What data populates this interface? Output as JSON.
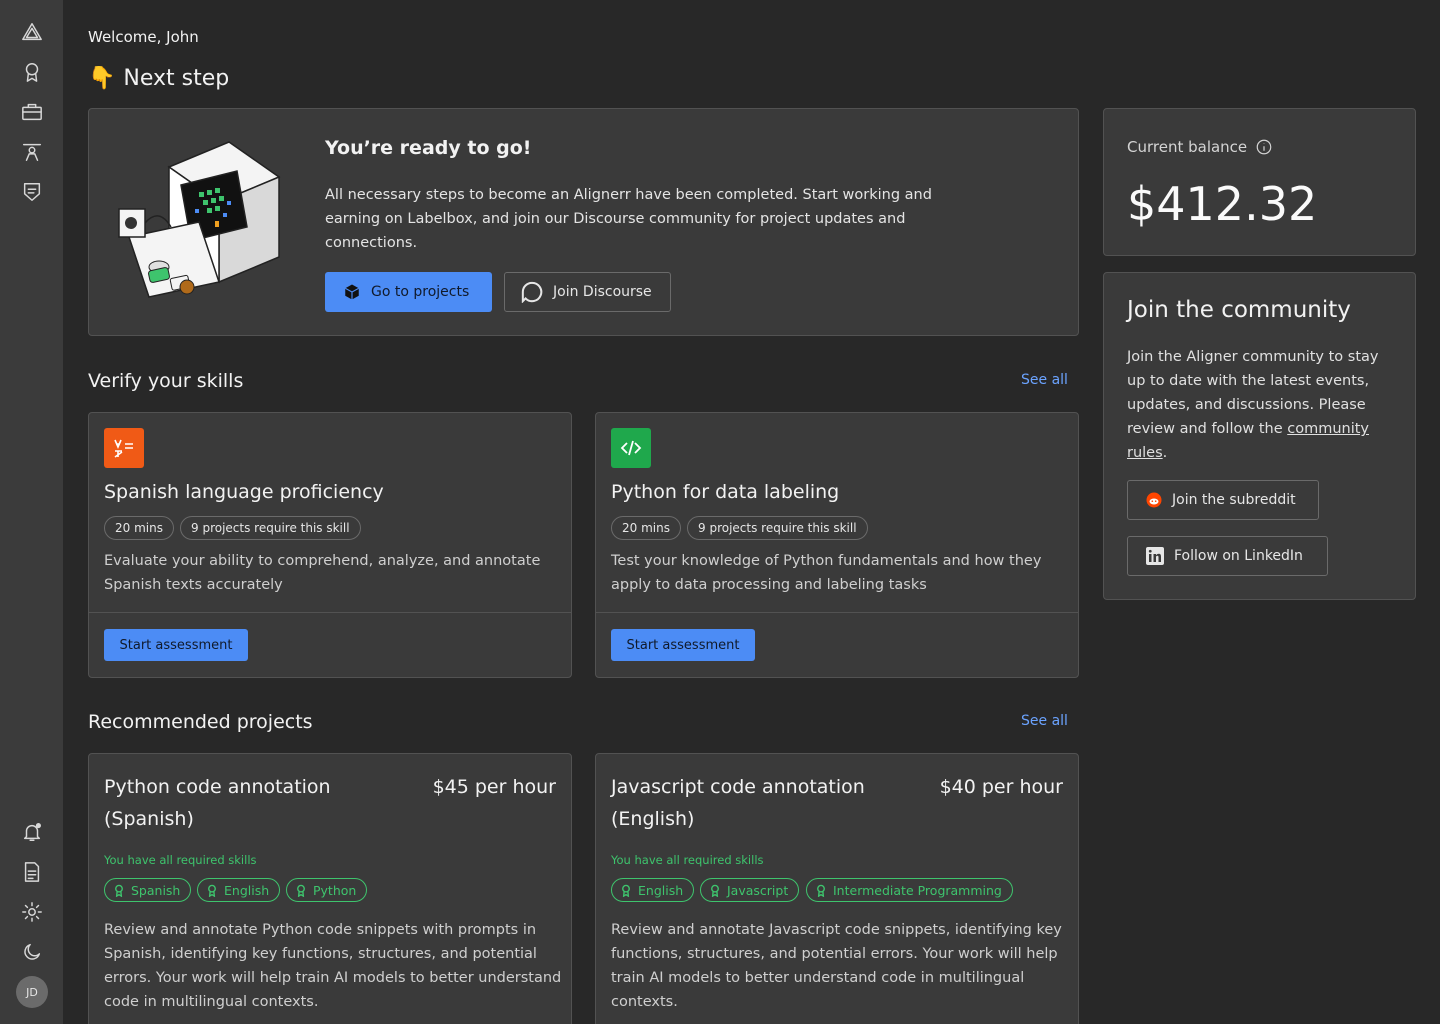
{
  "header": {
    "welcome": "Welcome, John",
    "next_step_emoji": "👇",
    "next_step": "Next step"
  },
  "sidebar": {
    "top_icons": [
      "logo-icon",
      "award-icon",
      "briefcase-icon",
      "teacher-icon",
      "shield-icon"
    ],
    "bottom_icons": [
      "bell-icon",
      "document-icon",
      "gear-icon",
      "moon-icon"
    ],
    "avatar_initials": "JD"
  },
  "hero": {
    "title": "You’re ready to go!",
    "description": "All necessary steps to become an Alignerr have been completed. Start working and earning on Labelbox, and join our Discourse community for project updates and connections.",
    "primary_button": "Go to projects",
    "secondary_button": "Join Discourse"
  },
  "skills": {
    "title": "Verify your skills",
    "see_all": "See all",
    "items": [
      {
        "name": "Spanish language proficiency",
        "duration": "20 mins",
        "projects": "9 projects require this skill",
        "description": "Evaluate your ability to comprehend, analyze, and annotate Spanish texts accurately",
        "button": "Start assessment",
        "icon_color": "#f05a16"
      },
      {
        "name": "Python for data labeling",
        "duration": "20 mins",
        "projects": "9 projects require this skill",
        "description": "Test your knowledge of Python fundamentals and how they apply to data processing and labeling tasks",
        "button": "Start assessment",
        "icon_color": "#1fa84c"
      }
    ]
  },
  "projects": {
    "title": "Recommended projects",
    "see_all": "See all",
    "items": [
      {
        "name": "Python code annotation (Spanish)",
        "rate": "$45 per hour",
        "requirement": "You have all required skills",
        "skills": [
          "Spanish",
          "English",
          "Python"
        ],
        "description": "Review and annotate Python code snippets with prompts in Spanish, identifying key functions, structures, and potential errors. Your work will help train AI models to better understand code in multilingual contexts."
      },
      {
        "name": "Javascript code annotation (English)",
        "rate": "$40 per hour",
        "requirement": "You have all required skills",
        "skills": [
          "English",
          "Javascript",
          "Intermediate Programming"
        ],
        "description": "Review and annotate Javascript code snippets, identifying key functions, structures, and potential errors. Your work will help train AI models to better understand code in multilingual contexts."
      }
    ]
  },
  "balance": {
    "label": "Current balance",
    "value": "$412.32"
  },
  "community": {
    "title": "Join the community",
    "description_prefix": "Join the Aligner community to stay up to date with the latest events, updates, and discussions. Please review and follow the ",
    "rules_link": "community rules",
    "description_suffix": ".",
    "subreddit_button": "Join the subreddit",
    "linkedin_button": "Follow on LinkedIn"
  },
  "colors": {
    "accent": "#4c8cf5",
    "success": "#3ec46d",
    "link": "#6ba3ff"
  }
}
